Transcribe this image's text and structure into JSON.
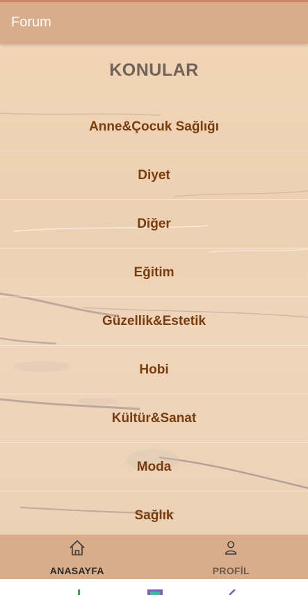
{
  "appbar": {
    "title": "Forum"
  },
  "content": {
    "heading": "KONULAR",
    "topics": [
      "Anne&Çocuk Sağlığı",
      "Diyet",
      "Diğer",
      "Eğitim",
      "Güzellik&Estetik",
      "Hobi",
      "Kültür&Sanat",
      "Moda",
      "Sağlık"
    ]
  },
  "bottom_nav": {
    "items": [
      {
        "label": "ANASAYFA",
        "icon": "home-icon",
        "active": true
      },
      {
        "label": "PROFİL",
        "icon": "person-icon",
        "active": false
      }
    ]
  },
  "colors": {
    "appbar": "#d9ad8a",
    "topic_text": "#7a3c0c",
    "heading_text": "#6f6259"
  }
}
